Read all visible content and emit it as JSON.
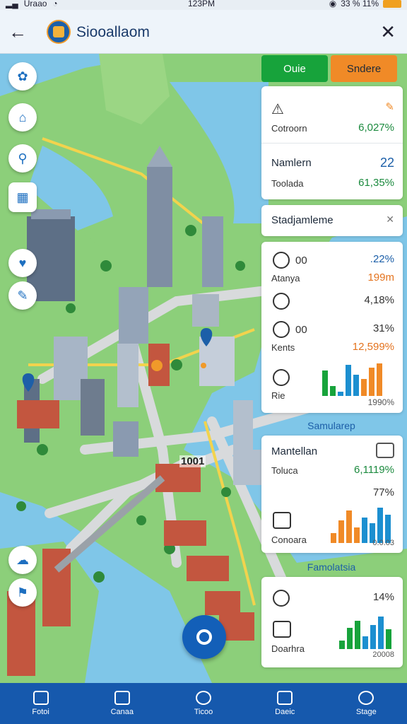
{
  "status": {
    "carrier": "Uraao",
    "time": "123PM",
    "battery": "33 % 11%"
  },
  "header": {
    "title": "Siooallaom",
    "back_icon": "back-arrow-icon",
    "close_icon": "close-icon"
  },
  "map": {
    "block_label": "1001"
  },
  "panel": {
    "tabs": [
      {
        "label": "Ouie",
        "color": "#17a33b"
      },
      {
        "label": "Sndere",
        "color": "#f08a27"
      }
    ],
    "card1": {
      "rows": [
        {
          "label": "Cotroorn",
          "value": "6,027%"
        },
        {
          "label": "Namlern",
          "value": "22"
        },
        {
          "label": "Toolada",
          "value": "61,35%"
        }
      ]
    },
    "card2": {
      "title": "Stadjamleme",
      "rows": [
        {
          "num": "00",
          "value": ".22%"
        },
        {
          "label": "Atanya",
          "value": "199m"
        },
        {
          "value": "4,18%"
        },
        {
          "num": "00",
          "value": "31%"
        },
        {
          "label": "Kents",
          "value": "12,599%"
        },
        {
          "label": "Rie",
          "value": "1990%"
        }
      ]
    },
    "card3": {
      "section": "Samularep",
      "rows": [
        {
          "label": "Mantellan",
          "value": ""
        },
        {
          "label": "Toluca",
          "value": "6,1119%"
        },
        {
          "value": "77%"
        },
        {
          "label": "Conoara",
          "value": "0.0.03"
        }
      ]
    },
    "card4": {
      "section": "Famolatsia",
      "rows": [
        {
          "value": "14%"
        },
        {
          "label": "Doarhra",
          "value": "20008"
        }
      ]
    }
  },
  "nav": [
    {
      "label": "Fotoi",
      "icon": "home-icon"
    },
    {
      "label": "Canaa",
      "icon": "map-icon"
    },
    {
      "label": "Ticoo",
      "icon": "search-icon"
    },
    {
      "label": "Daeic",
      "icon": "folder-icon"
    },
    {
      "label": "Stage",
      "icon": "chat-icon"
    }
  ]
}
